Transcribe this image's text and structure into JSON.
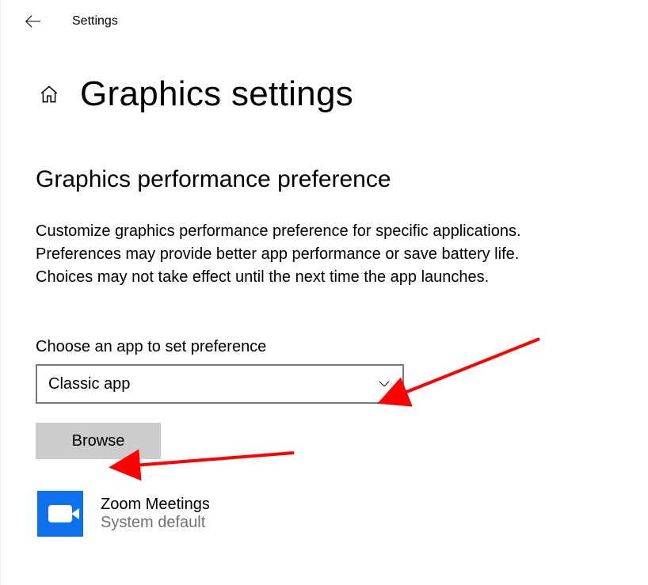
{
  "topbar": {
    "label": "Settings"
  },
  "page": {
    "title": "Graphics settings"
  },
  "section": {
    "heading": "Graphics performance preference",
    "description": "Customize graphics performance preference for specific applications. Preferences may provide better app performance or save battery life. Choices may not take effect until the next time the app launches."
  },
  "choose": {
    "label": "Choose an app to set preference",
    "dropdown_value": "Classic app",
    "browse_label": "Browse"
  },
  "apps": [
    {
      "name": "Zoom Meetings",
      "preference": "System default"
    }
  ]
}
